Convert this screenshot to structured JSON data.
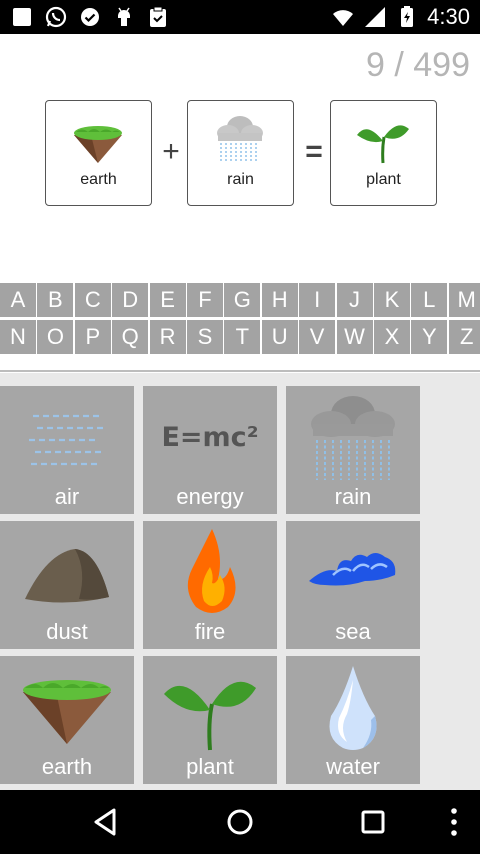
{
  "status_bar": {
    "time": "4:30",
    "left_icons": [
      "app-square-icon",
      "whatsapp-icon",
      "check-circle-icon",
      "android-icon",
      "clipboard-check-icon"
    ],
    "right_icons": [
      "wifi-icon",
      "signal-icon",
      "battery-icon"
    ]
  },
  "progress": "9 / 499",
  "recipe": {
    "ingredient_1": {
      "label": "earth",
      "icon": "earth-icon"
    },
    "plus": "+",
    "ingredient_2": {
      "label": "rain",
      "icon": "rain-icon"
    },
    "equals": "=",
    "result": {
      "label": "plant",
      "icon": "plant-icon"
    }
  },
  "alphabet": {
    "row1": [
      "A",
      "B",
      "C",
      "D",
      "E",
      "F",
      "G",
      "H",
      "I",
      "J",
      "K",
      "L",
      "M"
    ],
    "row2": [
      "N",
      "O",
      "P",
      "Q",
      "R",
      "S",
      "T",
      "U",
      "V",
      "W",
      "X",
      "Y",
      "Z"
    ]
  },
  "elements": [
    {
      "label": "air",
      "icon": "air-icon"
    },
    {
      "label": "energy",
      "icon": "energy-icon",
      "formula": "E=mc²"
    },
    {
      "label": "rain",
      "icon": "rain-icon"
    },
    {
      "label": "dust",
      "icon": "dust-icon"
    },
    {
      "label": "fire",
      "icon": "fire-icon"
    },
    {
      "label": "sea",
      "icon": "sea-icon"
    },
    {
      "label": "earth",
      "icon": "earth-icon"
    },
    {
      "label": "plant",
      "icon": "plant-icon"
    },
    {
      "label": "water",
      "icon": "water-icon"
    }
  ],
  "navbar": [
    "back-icon",
    "home-icon",
    "recents-icon",
    "overflow-menu-icon"
  ],
  "colors": {
    "tile_bg": "#a6a6a6",
    "letter_bg": "#a3a3a3",
    "progress_text": "#b5b5b5"
  }
}
